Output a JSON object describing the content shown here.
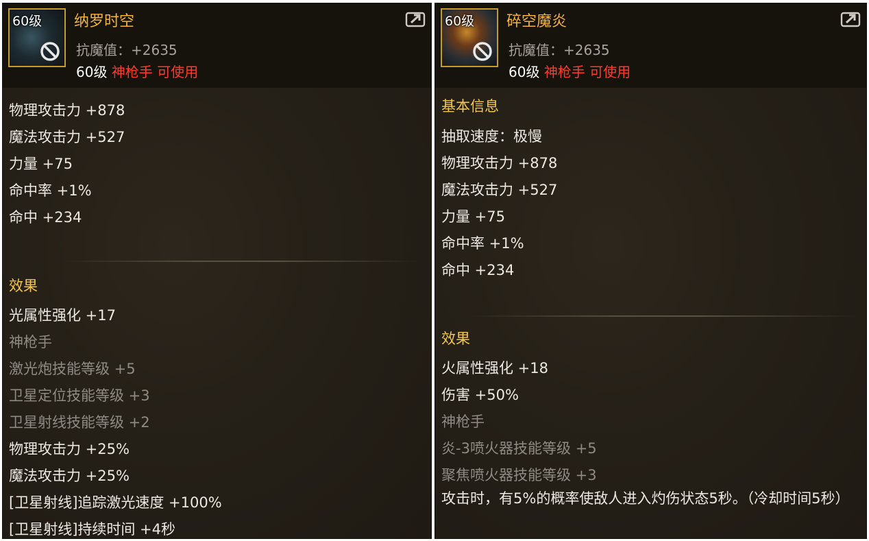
{
  "left": {
    "icon_level": "60级",
    "name": "纳罗时空",
    "anti_magic": "抗魔值：+2635",
    "use_level": "60级",
    "use_class": "神枪手 可使用",
    "stats": [
      "物理攻击力 +878",
      "魔法攻击力 +527",
      "力量 +75",
      "命中率 +1%",
      "命中 +234"
    ],
    "effect_title": "效果",
    "effect_white_1": "光属性强化 +17",
    "class_name": "神枪手",
    "skills": [
      "激光炮技能等级 +5",
      "卫星定位技能等级 +3",
      "卫星射线技能等级 +2"
    ],
    "effect_white_2": [
      "物理攻击力 +25%",
      "魔法攻击力 +25%",
      "[卫星射线]追踪激光速度 +100%",
      "[卫星射线]持续时间 +4秒"
    ]
  },
  "right": {
    "icon_level": "60级",
    "name": "碎空魔炎",
    "anti_magic": "抗魔值：+2635",
    "use_level": "60级",
    "use_class": "神枪手 可使用",
    "basic_title": "基本信息",
    "draw_speed": "抽取速度：极慢",
    "stats": [
      "物理攻击力 +878",
      "魔法攻击力 +527",
      "力量 +75",
      "命中率 +1%",
      "命中 +234"
    ],
    "effect_title": "效果",
    "effect_white": [
      "火属性强化 +18",
      "伤害 +50%"
    ],
    "class_name": "神枪手",
    "skills": [
      "炎-3喷火器技能等级 +5",
      "聚焦喷火器技能等级 +3"
    ],
    "proc_text": "攻击时，有5%的概率使敌人进入灼伤状态5秒。（冷却时间5秒）"
  },
  "colors": {
    "name": "#f3b33d",
    "class_red": "#ff3a2a",
    "section_gold": "#f2c64c",
    "text_white": "#ece8e2",
    "text_gray": "#8f8b84"
  },
  "icons": [
    "forbidden-icon",
    "share-icon"
  ]
}
